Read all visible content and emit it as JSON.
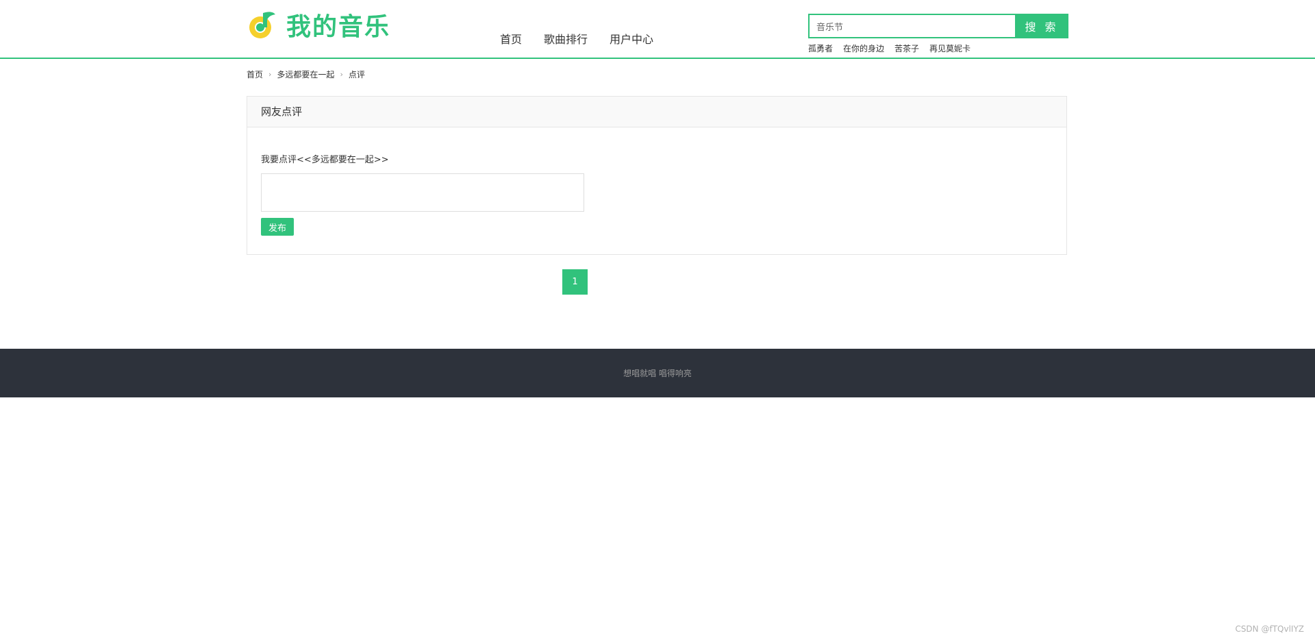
{
  "header": {
    "logo_text": "我的音乐",
    "nav": [
      "首页",
      "歌曲排行",
      "用户中心"
    ],
    "search": {
      "value": "音乐节",
      "button_label": "搜 索"
    },
    "hot_words": [
      "孤勇者",
      "在你的身边",
      "苦茶子",
      "再见莫妮卡"
    ]
  },
  "breadcrumb": {
    "items": [
      "首页",
      "多远都要在一起",
      "点评"
    ]
  },
  "comment": {
    "panel_title": "网友点评",
    "label": "我要点评<<多远都要在一起>>",
    "textarea_value": "",
    "publish_label": "发布"
  },
  "pagination": {
    "current": "1"
  },
  "footer": {
    "text": "想唱就唱 唱得响亮"
  },
  "watermark": "CSDN @fTQvlIYZ",
  "colors": {
    "accent": "#31c27c",
    "logo_yellow": "#f5d02c",
    "footer_bg": "#2d323b"
  }
}
